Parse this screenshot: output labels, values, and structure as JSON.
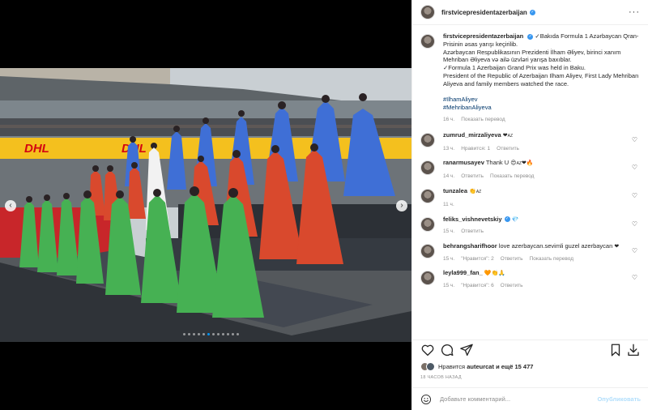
{
  "post": {
    "username": "firstvicepresidentazerbaijan",
    "caption_lines": [
      "✓Bakıda Formula 1 Azərbaycan Qran-Prisinin əsas yarışı keçirilib.",
      "Azərbaycan Respublikasının Prezidenti İlham Əliyev, birinci xanım Mehriban Əliyeva və ailə üzvləri yarışa baxıblar.",
      "✓Formula 1 Azerbaijan Grand Prix was held in Baku.",
      "President of the Republic of Azerbaijan Ilham Aliyev, First Lady Mehriban Aliyeva and family members watched the race."
    ],
    "hashtags": [
      "#IlhamAliyev",
      "#MehribanAliyeva"
    ],
    "caption_time": "16 ч.",
    "caption_translate": "Показать перевод"
  },
  "comments": [
    {
      "user": "zumrud_mirzaliyeva",
      "text": "",
      "emoji": "❤",
      "flag": "AZ",
      "time": "13 ч.",
      "likes": "Нравится: 1",
      "reply": "Ответить",
      "translate": ""
    },
    {
      "user": "ranarmusayev",
      "text": "Thank U",
      "emoji": "😍",
      "flag": "AZ",
      "emoji2": "❤🔥",
      "time": "14 ч.",
      "likes": "",
      "reply": "Ответить",
      "translate": "Показать перевод"
    },
    {
      "user": "tunzalea",
      "text": "",
      "emoji": "👏",
      "flag": "AZ",
      "time": "11 ч.",
      "likes": "",
      "reply": "",
      "translate": ""
    },
    {
      "user": "feliks_vishnevetskiy",
      "text": "",
      "emoji": "💎",
      "flag": "",
      "time": "15 ч.",
      "likes": "",
      "reply": "Ответить",
      "translate": ""
    },
    {
      "user": "behrangsharifhoor",
      "text": "love azerbaycan.sevimli guzel azerbaycan",
      "emoji": "❤",
      "flag": "",
      "time": "15 ч.",
      "likes": "\"Нравится\": 2",
      "reply": "Ответить",
      "translate": "Показать перевод"
    },
    {
      "user": "leyla999_fan_",
      "text": "",
      "emoji": "🧡👏🙏",
      "flag": "",
      "time": "15 ч.",
      "likes": "\"Нравится\": 6",
      "reply": "Ответить",
      "translate": ""
    }
  ],
  "likes_bar": {
    "prefix": "Нравится",
    "user": "auteurcat",
    "suffix": "и ещё 15 477"
  },
  "time_ago": "18 ЧАСОВ НАЗАД",
  "add_comment": {
    "placeholder": "Добавьте комментарий...",
    "publish": "Опубликовать"
  },
  "icons": {
    "more": "more-icon",
    "like": "heart-icon",
    "comment": "comment-icon",
    "share": "send-icon",
    "save": "bookmark-icon",
    "download": "download-icon",
    "emoji": "smile-icon"
  },
  "colors": {
    "link": "#00376b",
    "verified": "#3897f0",
    "publish": "#b2dffc",
    "meta": "#8e8e8e"
  },
  "carousel": {
    "total_slides": 12,
    "active_slide": 6
  }
}
